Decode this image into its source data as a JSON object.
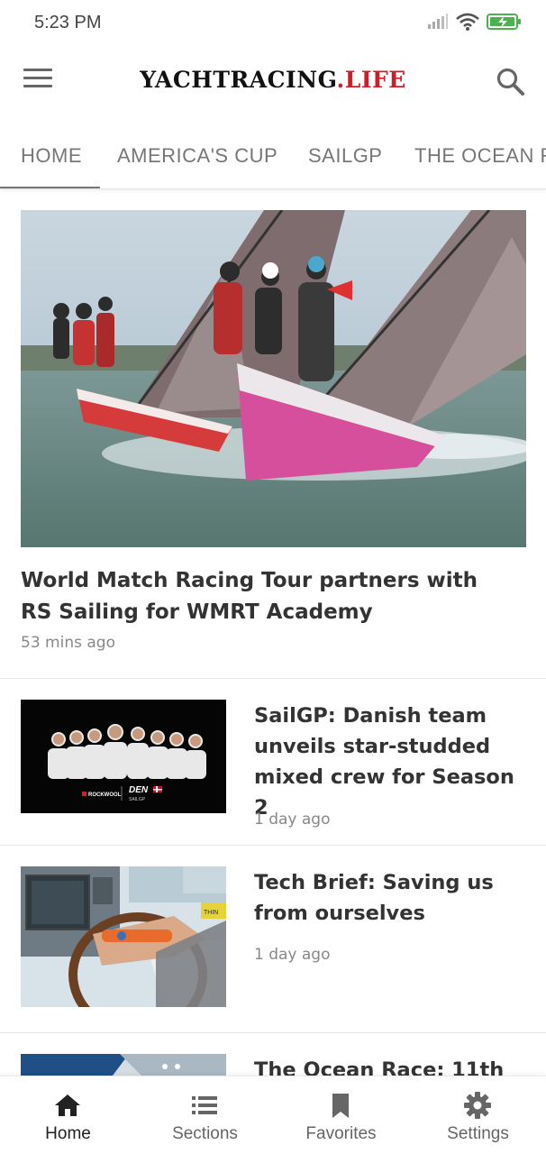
{
  "status_bar": {
    "time": "5:23 PM",
    "icons": [
      "signal-icon",
      "wifi-icon",
      "battery-charging-icon"
    ],
    "battery_color": "#4caf50"
  },
  "app_bar": {
    "logo_main": "YACHTRACING",
    "logo_suffix": ".LIFE",
    "logo_accent_color": "#c8202a",
    "menu_icon": "hamburger-menu-icon",
    "search_icon": "search-icon"
  },
  "tabs": [
    {
      "label": "HOME",
      "active": true
    },
    {
      "label": "AMERICA'S CUP",
      "active": false
    },
    {
      "label": "SAILGP",
      "active": false
    },
    {
      "label": "THE OCEAN RACE",
      "active": false
    }
  ],
  "feed": {
    "hero": {
      "title": "World Match Racing Tour partners with RS Sailing for WMRT Academy",
      "time": "53 mins ago"
    },
    "articles": [
      {
        "title": "SailGP: Danish team unveils star-studded mixed crew for Season 2",
        "time": "1 day ago",
        "thumb_caption": "DEN",
        "thumb_sponsor": "ROCKWOOL",
        "thumb_sub": "SAILGP"
      },
      {
        "title": "Tech Brief: Saving us from ourselves",
        "time": "1 day ago",
        "thumb_caption": "THIN"
      },
      {
        "title": "The Ocean Race: 11th"
      }
    ]
  },
  "bottom_nav": [
    {
      "label": "Home",
      "icon": "home-icon",
      "active": true
    },
    {
      "label": "Sections",
      "icon": "list-icon",
      "active": false
    },
    {
      "label": "Favorites",
      "icon": "bookmark-icon",
      "active": false
    },
    {
      "label": "Settings",
      "icon": "gear-icon",
      "active": false
    }
  ]
}
